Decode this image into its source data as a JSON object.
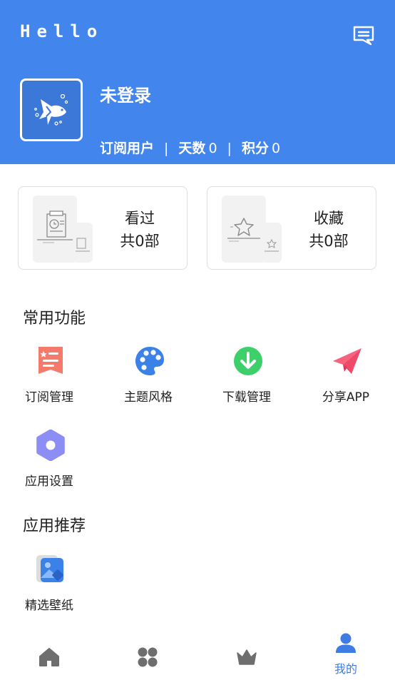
{
  "header": {
    "app_title": "Hello",
    "message_icon": "message-bubble-icon",
    "username": "未登录",
    "stats": {
      "user_type": "订阅用户",
      "days_label": "天数",
      "days_value": "0",
      "points_label": "积分",
      "points_value": "0",
      "separator": "|"
    }
  },
  "cards": [
    {
      "title": "看过",
      "count": "共0部",
      "icon": "history-illustration"
    },
    {
      "title": "收藏",
      "count": "共0部",
      "icon": "star-illustration"
    }
  ],
  "sections": {
    "common_title": "常用功能",
    "recommend_title": "应用推荐"
  },
  "functions": [
    {
      "label": "订阅管理",
      "icon": "subscription-icon",
      "color": "#f47a6b"
    },
    {
      "label": "主题风格",
      "icon": "palette-icon",
      "color": "#3b82e8"
    },
    {
      "label": "下载管理",
      "icon": "download-icon",
      "color": "#3ccf6a"
    },
    {
      "label": "分享APP",
      "icon": "paper-plane-icon",
      "color": "#f7627d"
    },
    {
      "label": "应用设置",
      "icon": "settings-gear-icon",
      "color": "#8c8ef5"
    }
  ],
  "recommend": [
    {
      "label": "精选壁纸",
      "icon": "wallpaper-icon",
      "color": "#3b82e8"
    }
  ],
  "tabbar": {
    "tabs": [
      {
        "icon": "home-icon",
        "label": ""
      },
      {
        "icon": "apps-grid-icon",
        "label": ""
      },
      {
        "icon": "crown-icon",
        "label": ""
      },
      {
        "icon": "user-icon",
        "label": "我的",
        "active": true
      }
    ],
    "active_color": "#3e7ce4",
    "inactive_color": "#6e6e6e"
  },
  "colors": {
    "header_bg": "#4285ec",
    "text": "#222222"
  }
}
